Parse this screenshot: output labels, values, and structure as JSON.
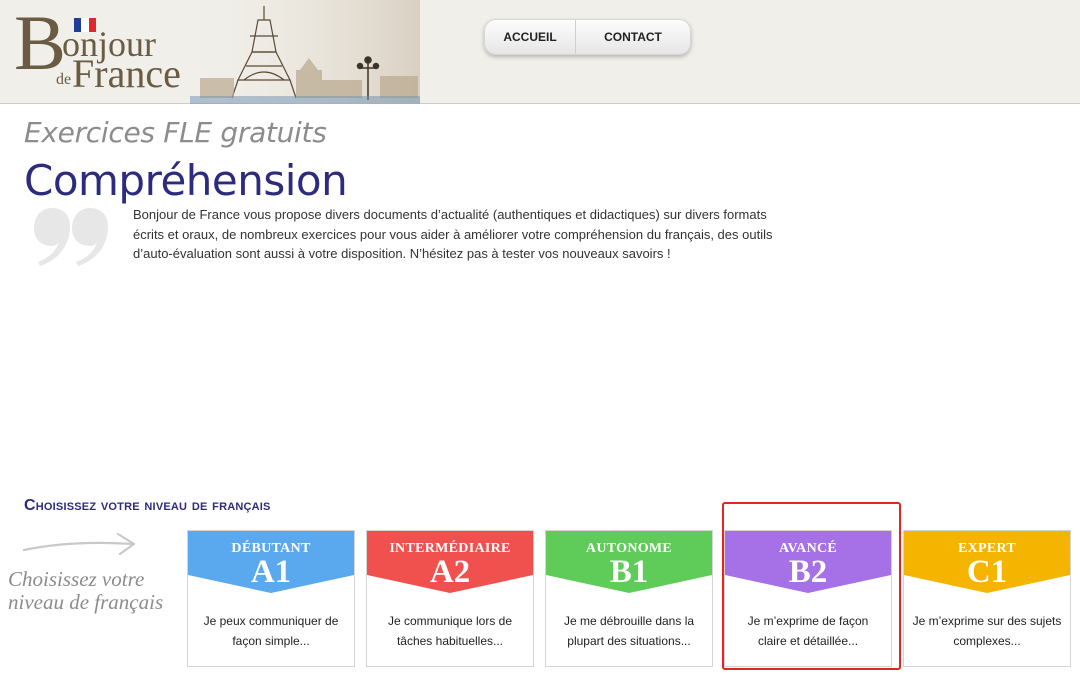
{
  "logo": {
    "line1": "Bonjour",
    "line2_small": "de",
    "line2": "France"
  },
  "nav": {
    "accueil": "ACCUEIL",
    "contact": "CONTACT"
  },
  "page": {
    "subtitle": "Exercices FLE gratuits",
    "title": "Compréhension",
    "intro": "Bonjour de France vous propose divers documents d’actualité (authentiques et didactiques) sur divers formats écrits et oraux, de nombreux exercices pour vous aider à améliorer votre compréhension du français, des outils d’auto-évaluation sont aussi à votre disposition. N’hésitez pas à tester vos nouveaux savoirs !"
  },
  "levels": {
    "heading": "Choisissez votre niveau de français",
    "side_note": "Choisissez votre niveau de français",
    "cards": [
      {
        "name": "DÉBUTANT",
        "code": "A1",
        "desc": "Je peux communiquer de façon simple...",
        "color": "#5aa9ee"
      },
      {
        "name": "INTERMÉDIAIRE",
        "code": "A2",
        "desc": "Je communique lors de tâches habituelles...",
        "color": "#f0514f"
      },
      {
        "name": "AUTONOME",
        "code": "B1",
        "desc": "Je me débrouille dans la plupart des situations...",
        "color": "#5fcc5a"
      },
      {
        "name": "AVANCÉ",
        "code": "B2",
        "desc": "Je m’exprime de façon claire et détaillée...",
        "color": "#a670e6"
      },
      {
        "name": "EXPERT",
        "code": "C1",
        "desc": "Je m’exprime sur des sujets complexes...",
        "color": "#f4b400"
      }
    ]
  },
  "icons": {
    "quote": "quote-mark-icon",
    "arrow": "arrow-right-icon",
    "flag": "french-flag-icon"
  },
  "colors": {
    "title": "#2d2b7d",
    "highlight": "#e0271f"
  }
}
